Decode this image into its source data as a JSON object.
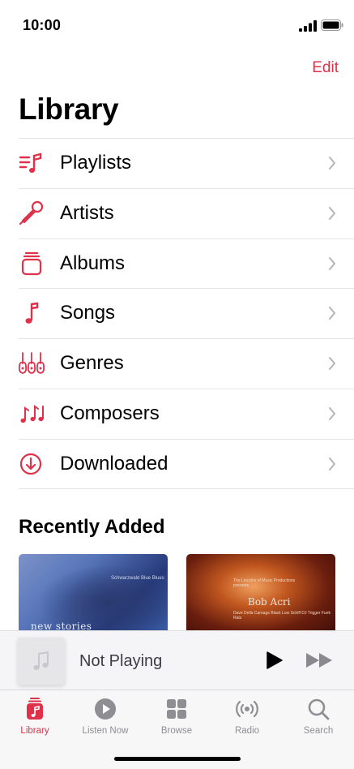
{
  "status_bar": {
    "time": "10:00"
  },
  "header": {
    "edit_label": "Edit",
    "title": "Library"
  },
  "menu": {
    "items": [
      {
        "label": "Playlists",
        "icon": "playlists-icon"
      },
      {
        "label": "Artists",
        "icon": "microphone-icon"
      },
      {
        "label": "Albums",
        "icon": "album-stack-icon"
      },
      {
        "label": "Songs",
        "icon": "music-note-icon"
      },
      {
        "label": "Genres",
        "icon": "guitars-icon"
      },
      {
        "label": "Composers",
        "icon": "composers-notes-icon"
      },
      {
        "label": "Downloaded",
        "icon": "download-circle-icon"
      }
    ]
  },
  "recently_added": {
    "title": "Recently Added",
    "albums": [
      {
        "art_text": "new stories",
        "art_subtext": "Schwarzwald Blue Blues"
      },
      {
        "art_text": "Bob Acri",
        "art_subtext": "The Lincolns of Music Productions presents",
        "art_subtext2": "Dave Della Carnage Black Low Schiff DJ Trigger Funk Rats"
      }
    ]
  },
  "mini_player": {
    "title": "Not Playing"
  },
  "tab_bar": {
    "tabs": [
      {
        "label": "Library",
        "icon": "library-icon",
        "active": true
      },
      {
        "label": "Listen Now",
        "icon": "play-circle-icon",
        "active": false
      },
      {
        "label": "Browse",
        "icon": "grid-icon",
        "active": false
      },
      {
        "label": "Radio",
        "icon": "radio-waves-icon",
        "active": false
      },
      {
        "label": "Search",
        "icon": "search-icon",
        "active": false
      }
    ]
  },
  "colors": {
    "accent": "#e0314a",
    "secondary_text": "#8e8e93"
  }
}
